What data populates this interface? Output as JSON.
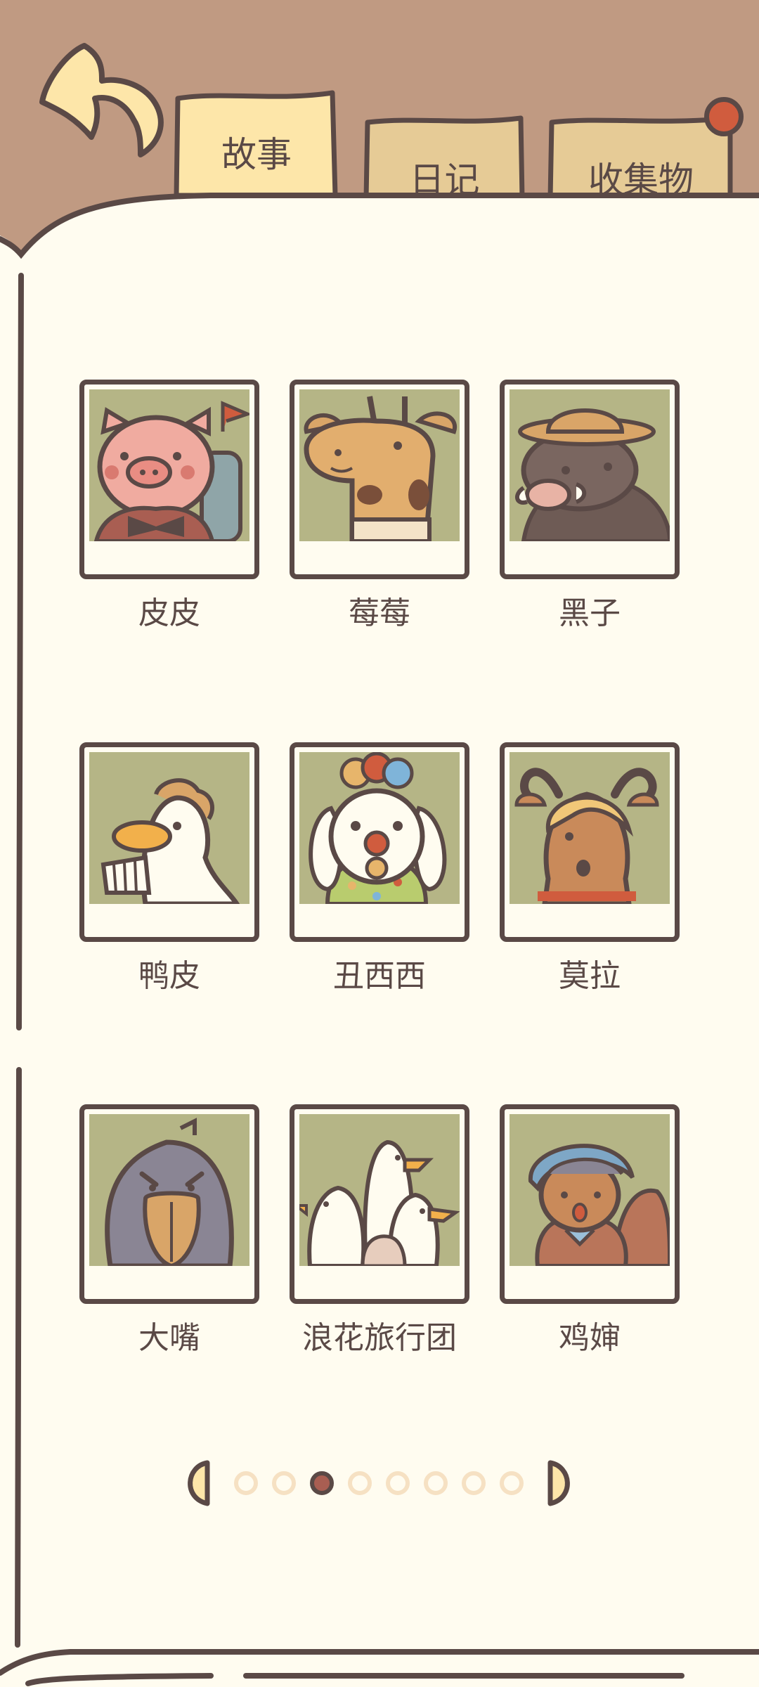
{
  "tabs": [
    {
      "label": "故事",
      "active": true
    },
    {
      "label": "日记",
      "active": false
    },
    {
      "label": "收集物",
      "active": false,
      "has_badge": true
    }
  ],
  "characters": [
    {
      "name": "皮皮",
      "icon": "pig-icon"
    },
    {
      "name": "莓莓",
      "icon": "giraffe-icon"
    },
    {
      "name": "黑子",
      "icon": "boar-icon"
    },
    {
      "name": "鸭皮",
      "icon": "duck-icon"
    },
    {
      "name": "丑西西",
      "icon": "clown-dog-icon"
    },
    {
      "name": "莫拉",
      "icon": "goat-icon"
    },
    {
      "name": "大嘴",
      "icon": "shoebill-icon"
    },
    {
      "name": "浪花旅行团",
      "icon": "seagulls-icon"
    },
    {
      "name": "鸡婶",
      "icon": "hen-icon"
    }
  ],
  "pager": {
    "total_pages": 8,
    "current_page": 3
  },
  "colors": {
    "background": "#c09a82",
    "paper": "#fffcf0",
    "outline": "#5a4946",
    "tab_active": "#fde6a9",
    "tab_inactive": "#e6cb96",
    "photo_bg": "#b5b586",
    "badge": "#d05c3e",
    "dot_inactive": "#f6e1c3",
    "dot_active": "#a95e52"
  }
}
